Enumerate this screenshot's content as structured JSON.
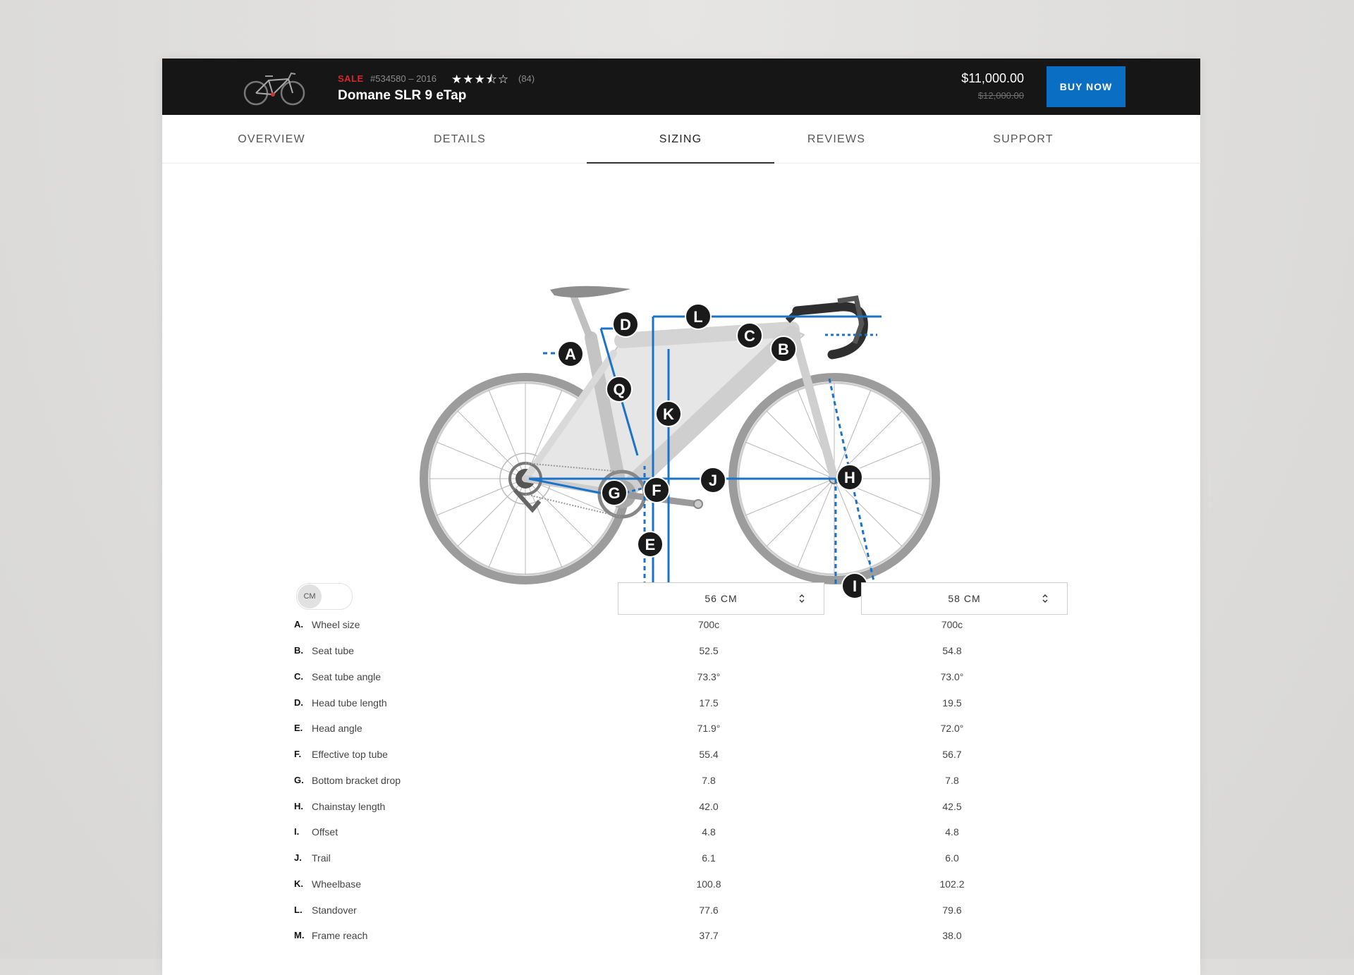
{
  "header": {
    "sale_label": "SALE",
    "sku": "#534580 – 2016",
    "rating": 3.5,
    "rating_max": 5,
    "stars_text": "★★★⯪☆",
    "review_count": "(84)",
    "product_name": "Domane SLR 9 eTap",
    "price": "$11,000.00",
    "old_price": "$12,000.00",
    "buy_label": "BUY NOW"
  },
  "tabs": [
    {
      "label": "OVERVIEW"
    },
    {
      "label": "DETAILS"
    },
    {
      "label": "SIZING",
      "active": true
    },
    {
      "label": "REVIEWS"
    },
    {
      "label": "SUPPORT"
    }
  ],
  "diagram": {
    "markers": [
      "A",
      "B",
      "C",
      "D",
      "E",
      "F",
      "G",
      "H",
      "I",
      "J",
      "K",
      "L",
      "Q"
    ]
  },
  "controls": {
    "unit_toggle": "CM",
    "size_left": "56 CM",
    "size_right": "58 CM"
  },
  "specs": [
    {
      "letter": "A.",
      "label": "Wheel size",
      "v1": "700c",
      "v2": "700c"
    },
    {
      "letter": "B.",
      "label": "Seat tube",
      "v1": "52.5",
      "v2": "54.8"
    },
    {
      "letter": "C.",
      "label": "Seat tube angle",
      "v1": "73.3°",
      "v2": "73.0°"
    },
    {
      "letter": "D.",
      "label": "Head tube length",
      "v1": "17.5",
      "v2": "19.5"
    },
    {
      "letter": "E.",
      "label": "Head angle",
      "v1": "71.9°",
      "v2": "72.0°"
    },
    {
      "letter": "F.",
      "label": "Effective top tube",
      "v1": "55.4",
      "v2": "56.7"
    },
    {
      "letter": "G.",
      "label": "Bottom bracket drop",
      "v1": "7.8",
      "v2": "7.8"
    },
    {
      "letter": "H.",
      "label": "Chainstay length",
      "v1": "42.0",
      "v2": "42.5"
    },
    {
      "letter": "I.",
      "label": "Offset",
      "v1": "4.8",
      "v2": "4.8"
    },
    {
      "letter": "J.",
      "label": "Trail",
      "v1": "6.1",
      "v2": "6.0"
    },
    {
      "letter": "K.",
      "label": "Wheelbase",
      "v1": "100.8",
      "v2": "102.2"
    },
    {
      "letter": "L.",
      "label": "Standover",
      "v1": "77.6",
      "v2": "79.6"
    },
    {
      "letter": "M.",
      "label": "Frame reach",
      "v1": "37.7",
      "v2": "38.0"
    }
  ],
  "colors": {
    "topbar": "#161616",
    "accent_blue": "#0a6fc2",
    "sale_red": "#d9262c",
    "measure_line": "#1a73c8",
    "marker": "#1a1a1a"
  }
}
